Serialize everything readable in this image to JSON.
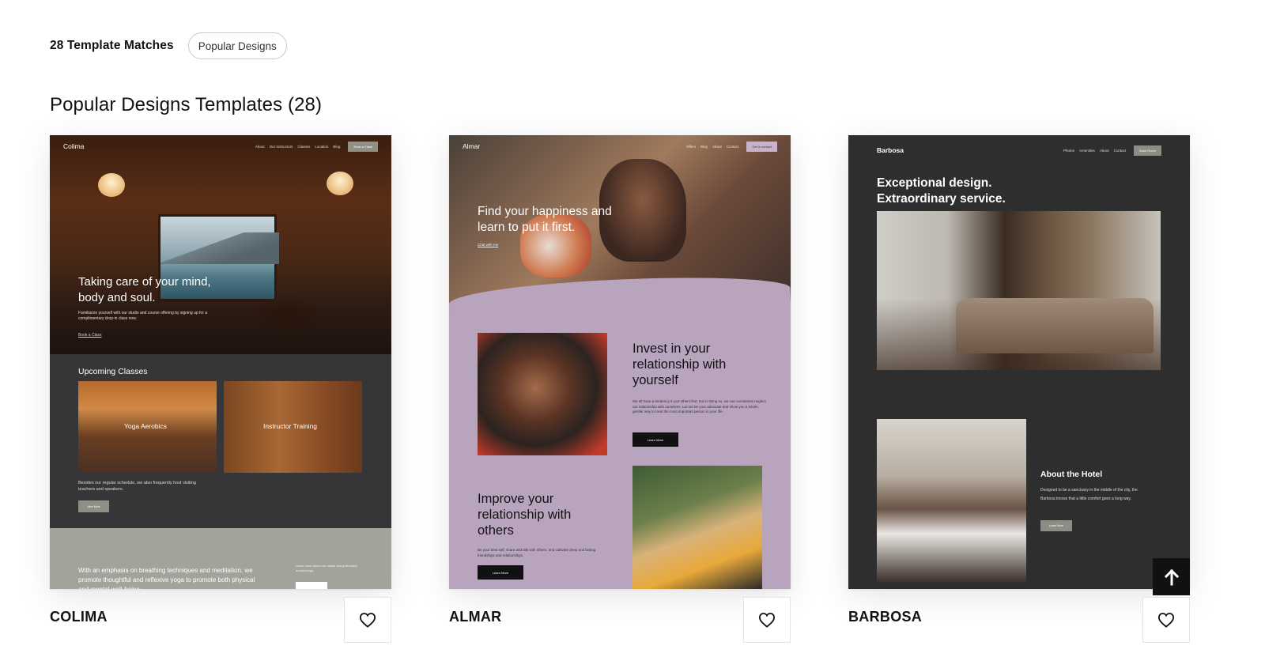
{
  "header": {
    "match_count": "28 Template Matches",
    "filter_pill": "Popular Designs"
  },
  "section_title": "Popular Designs Templates (28)",
  "templates": [
    {
      "name": "COLIMA",
      "preview": {
        "logo": "Colima",
        "nav_links": [
          "About",
          "Our Instructors",
          "Classes",
          "Location",
          "Blog"
        ],
        "nav_cta": "Book a Class",
        "hero_heading": "Taking care of your mind, body and soul.",
        "hero_text": "Familiarize yourself with our studio and course offering by signing up for a complimentary drop-in class now.",
        "hero_link": "Book a Class",
        "upcoming_heading": "Upcoming Classes",
        "classes": [
          "Yoga Aerobics",
          "Instructor Training"
        ],
        "classes_text": "Besides our regular schedule, we also frequently host visiting teachers and speakers.",
        "classes_button": "View More",
        "footer_text": "With an emphasis on breathing techniques and meditation, we promote thoughtful and reflexive yoga to promote both physical and mental well-being.",
        "footer_side_text": "Learn more about our studio and philosophy around yoga."
      }
    },
    {
      "name": "ALMAR",
      "preview": {
        "logo": "Almar",
        "nav_links": [
          "Offers",
          "Blog",
          "About",
          "Contact"
        ],
        "nav_cta": "Get in contact",
        "hero_heading": "Find your happiness and learn to put it first.",
        "hero_link": "Chat with me",
        "section1_heading": "Invest in your relationship with yourself",
        "section1_text": "We all have a tendency to put others first, but in doing so, we can sometimes neglect our relationship with ourselves. Let me be your advocate and show you a kinder, gentler way to treat the most important person in your life.",
        "section1_button": "Learn More",
        "section2_heading": "Improve your relationship with others",
        "section2_text": "Be your best self, share and talk with others, and cultivate deep and lasting friendships and relationships.",
        "section2_button": "Learn More"
      }
    },
    {
      "name": "BARBOSA",
      "preview": {
        "logo": "Barbosa",
        "nav_links": [
          "Photos",
          "Amenities",
          "About",
          "Contact"
        ],
        "nav_cta": "Book Room",
        "hero_heading": "Exceptional design. Extraordinary service.",
        "about_heading": "About the Hotel",
        "about_text": "Designed to be a sanctuary in the middle of the city, the Barbosa knows that a little comfort goes a long way.",
        "about_button": "Learn More"
      }
    }
  ],
  "icons": {
    "favorite": "heart-outline-icon",
    "scroll_top": "arrow-up-icon"
  },
  "colors": {
    "almar_lavender": "#b9a4be",
    "colima_charcoal": "#363638",
    "barbosa_dark": "#2e2e2e"
  }
}
